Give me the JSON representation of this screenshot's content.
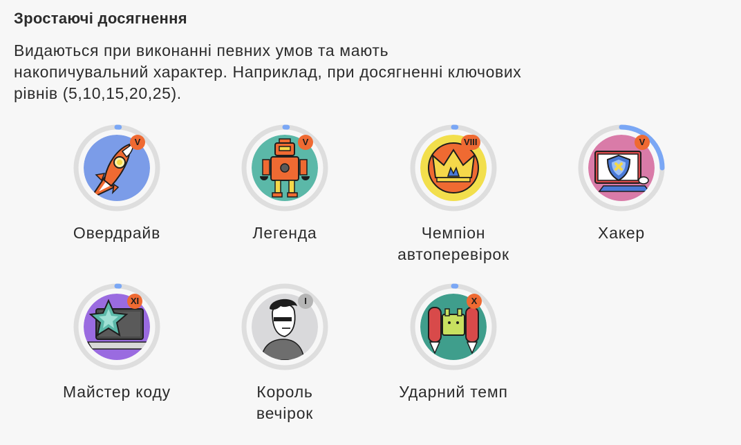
{
  "section": {
    "title": "Зростаючі досягнення",
    "description_lines": [
      "Видаються при виконанні певних умов та мають",
      "накопичувальний характер. Наприклад, при досягненні ключових",
      "рівнів (5,10,15,20,25)."
    ]
  },
  "badges": [
    {
      "name_lines": [
        "Овердрайв"
      ],
      "level": "V",
      "art": "rocket-icon",
      "progress": 0.01
    },
    {
      "name_lines": [
        "Легенда"
      ],
      "level": "V",
      "art": "robot-icon",
      "progress": 0.01
    },
    {
      "name_lines": [
        "Чемпіон",
        "автоперевірок"
      ],
      "level": "VIII",
      "art": "crown-icon",
      "progress": 0.01
    },
    {
      "name_lines": [
        "Хакер"
      ],
      "level": "V",
      "art": "shield-monitor-icon",
      "progress": 0.25
    },
    {
      "name_lines": [
        "Майстер коду"
      ],
      "level": "XI",
      "art": "star-laptop-icon",
      "progress": 0.01
    },
    {
      "name_lines": [
        "Король",
        "вечірок"
      ],
      "level": "I",
      "art": "party-person-icon",
      "progress": 0.0
    },
    {
      "name_lines": [
        "Ударний темп"
      ],
      "level": "X",
      "art": "jetpack-icon",
      "progress": 0.01
    }
  ],
  "colors": {
    "ring_track": "#dedede",
    "ring_progress": "#7aa7f5",
    "level_badge": "#ef6a32",
    "level_badge_inactive": "#b5b5b5"
  }
}
